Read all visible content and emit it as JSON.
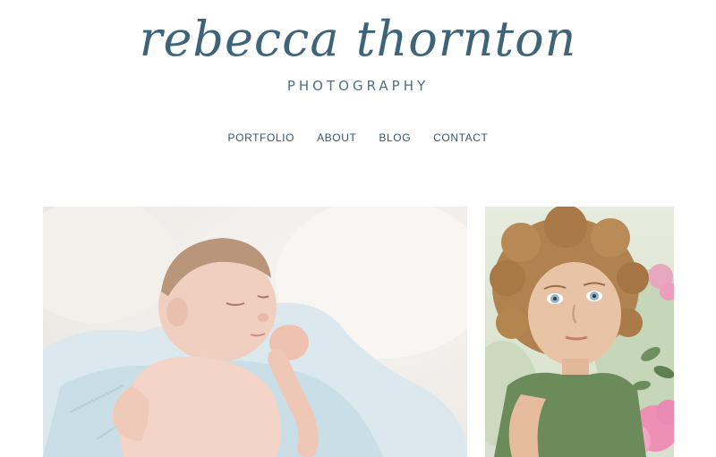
{
  "header": {
    "logo_script": "rebecca thornton",
    "logo_subtitle": "PHOTOGRAPHY"
  },
  "nav": {
    "items": [
      {
        "label": "PORTFOLIO"
      },
      {
        "label": "ABOUT"
      },
      {
        "label": "BLOG"
      },
      {
        "label": "CONTACT"
      }
    ]
  },
  "gallery": {
    "photos": [
      {
        "subject": "newborn-baby-sleeping"
      },
      {
        "subject": "curly-haired-child"
      }
    ]
  },
  "colors": {
    "brand": "#3d6478",
    "nav_text": "#3b5564"
  }
}
